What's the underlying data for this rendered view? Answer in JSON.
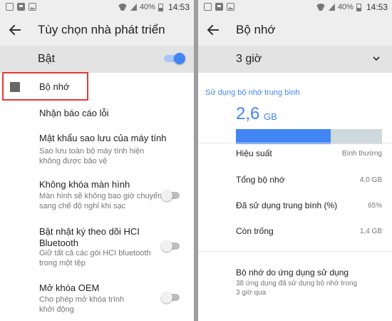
{
  "status_bar": {
    "battery": "40%",
    "time": "14:53"
  },
  "left": {
    "title": "Tùy chọn nhà phát triển",
    "master_toggle_label": "Bật",
    "memory_item": "Bộ nhớ",
    "items": [
      {
        "title": "Nhận báo cáo lỗi"
      },
      {
        "title": "Mật khẩu sao lưu của máy tính",
        "subtitle": "Sao lưu toàn bộ máy tính hiện không được bảo vệ"
      },
      {
        "title": "Không khóa màn hình",
        "subtitle": "Màn hình sẽ không bao giờ chuyển sang chế độ nghỉ khi sạc"
      },
      {
        "title": "Bật nhật ký theo dõi HCI Bluetooth",
        "subtitle": "Giữ tất cả các gói HCI bluetooth trong một tệp"
      },
      {
        "title": "Mở khóa OEM",
        "subtitle": "Cho phép mở khóa trình khởi động"
      }
    ]
  },
  "right": {
    "title": "Bộ nhớ",
    "period": "3 giờ",
    "avg_label": "Sử dụng bộ nhớ trung bình",
    "avg_value": "2,6",
    "avg_unit": "GB",
    "usage_fraction": 0.65,
    "stats": [
      {
        "label": "Hiệu suất",
        "value": "Bình thường"
      },
      {
        "label": "Tổng bộ nhớ",
        "value": "4,0 GB"
      },
      {
        "label": "Đã sử dụng trung bình (%)",
        "value": "65%"
      },
      {
        "label": "Còn trống",
        "value": "1,4 GB"
      }
    ],
    "apps_title": "Bộ nhớ do ứng dụng sử dụng",
    "apps_subtitle": "38 ứng dụng đã sử dụng bộ nhớ trong 3 giờ qua"
  },
  "colors": {
    "accent": "#4285f4",
    "highlight": "#e53935"
  }
}
